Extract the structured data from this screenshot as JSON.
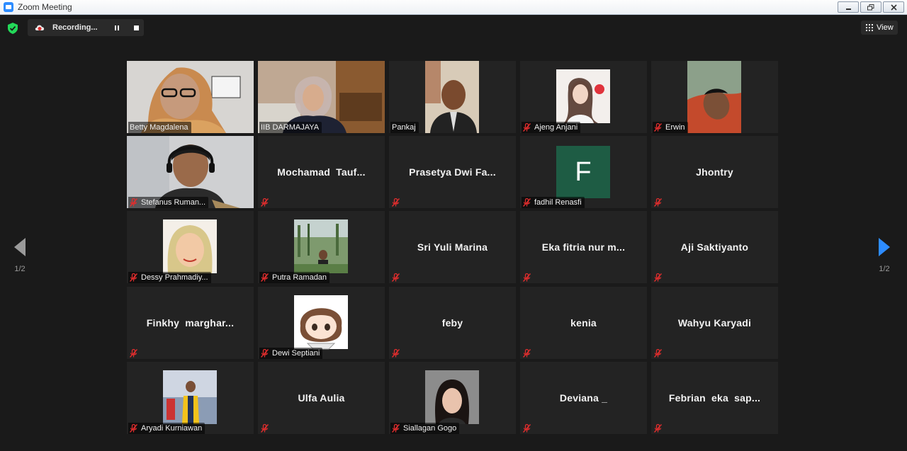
{
  "window": {
    "title": "Zoom Meeting"
  },
  "topbar": {
    "recording_label": "Recording...",
    "view_label": "View"
  },
  "pagination": {
    "left": "1/2",
    "right": "1/2"
  },
  "colors": {
    "accent": "#2d8cff",
    "active_speaker": "#b9e24e",
    "mute_red": "#e02d2d",
    "avatar_bg": "#1e5c44"
  },
  "participants": [
    {
      "name": "Betty Magdalena",
      "muted": false,
      "video": true
    },
    {
      "name": "IIB DARMAJAYA",
      "muted": false,
      "video": true,
      "active": true
    },
    {
      "name": "Pankaj",
      "muted": false,
      "video": true
    },
    {
      "name": "Ajeng Anjani",
      "muted": true,
      "video": true
    },
    {
      "name": "Erwin",
      "muted": true,
      "video": true
    },
    {
      "name": "Stefanus Ruman...",
      "muted": true,
      "video": true
    },
    {
      "name": "Mochamad  Tauf...",
      "muted": true,
      "video": false
    },
    {
      "name": "Prasetya Dwi Fa...",
      "muted": true,
      "video": false
    },
    {
      "name": "fadhil Renasfi",
      "muted": true,
      "video": false,
      "avatar_letter": "F"
    },
    {
      "name": "Jhontry",
      "muted": true,
      "video": false
    },
    {
      "name": "Dessy Prahmadiy...",
      "muted": true,
      "video": true
    },
    {
      "name": "Putra Ramadan",
      "muted": true,
      "video": true
    },
    {
      "name": "Sri Yuli Marina",
      "muted": true,
      "video": false
    },
    {
      "name": "Eka fitria nur m...",
      "muted": true,
      "video": false
    },
    {
      "name": "Aji Saktiyanto",
      "muted": true,
      "video": false
    },
    {
      "name": "Finkhy  marghar...",
      "muted": true,
      "video": false
    },
    {
      "name": "Dewi Septiani",
      "muted": true,
      "video": true
    },
    {
      "name": "feby",
      "muted": true,
      "video": false
    },
    {
      "name": "kenia",
      "muted": true,
      "video": false
    },
    {
      "name": "Wahyu Karyadi",
      "muted": true,
      "video": false
    },
    {
      "name": "Aryadi Kurniawan",
      "muted": true,
      "video": true
    },
    {
      "name": "Ulfa Aulia",
      "muted": true,
      "video": false
    },
    {
      "name": "Siallagan Gogo",
      "muted": true,
      "video": true
    },
    {
      "name": "Deviana _",
      "muted": true,
      "video": false
    },
    {
      "name": "Febrian  eka  sap...",
      "muted": true,
      "video": false
    }
  ]
}
